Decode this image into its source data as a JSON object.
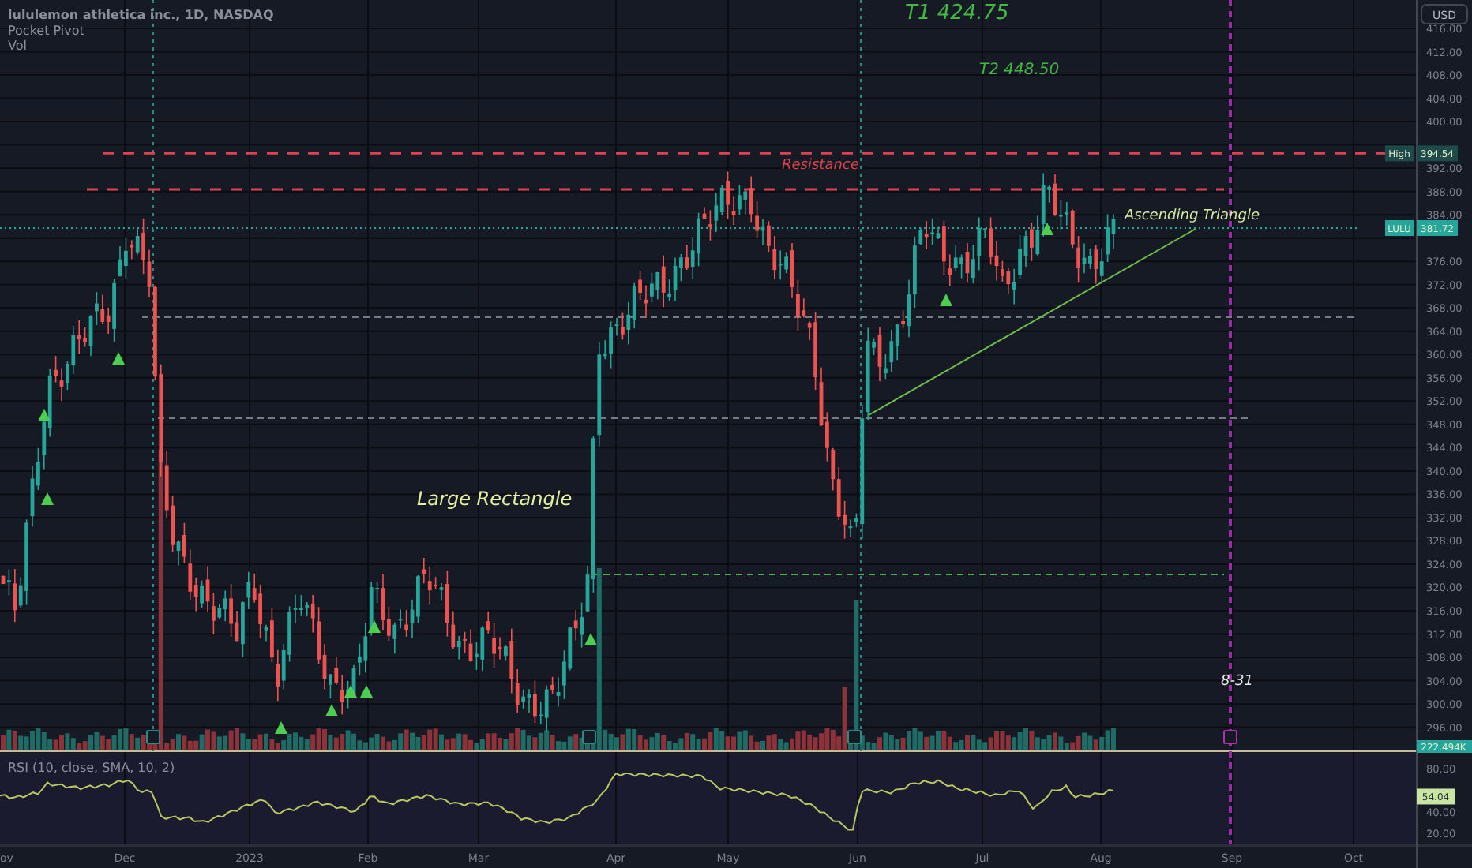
{
  "legend": {
    "symbol": "lululemon athletica inc., 1D, NASDAQ",
    "indicators": [
      "Pocket Pivot",
      "Vol"
    ]
  },
  "annotations": [
    {
      "text": "T1 424.75",
      "color": "#43b843"
    },
    {
      "text": "T2 448.50",
      "color": "#43b843"
    },
    {
      "text": "Resistance",
      "color": "#d8434b"
    },
    {
      "text": "Ascending Triangle",
      "color": "#d4eba0"
    },
    {
      "text": "Large Rectangle",
      "color": "#e6f0a0"
    },
    {
      "text": "8-31",
      "color": "#e8e8e8"
    }
  ],
  "price_axis": {
    "currency": "USD",
    "labels": [
      "416.00",
      "412.00",
      "408.00",
      "404.00",
      "400.00",
      "392.00",
      "388.00",
      "384.00",
      "376.00",
      "372.00",
      "368.00",
      "364.00",
      "360.00",
      "356.00",
      "352.00",
      "348.00",
      "344.00",
      "340.00",
      "336.00",
      "332.00",
      "328.00",
      "324.00",
      "320.00",
      "316.00",
      "312.00",
      "308.00",
      "304.00",
      "300.00",
      "296.00"
    ]
  },
  "price_badges": [
    {
      "kind": "high",
      "label": "High",
      "value": "394.54"
    },
    {
      "kind": "last",
      "label": "LULU",
      "value": "381.72"
    }
  ],
  "volume_badge": "222.494K",
  "rsi": {
    "title": "RSI (10, close, SMA, 10, 2)",
    "value": "54.04",
    "labels": [
      "80.00",
      "40.00",
      "20.00"
    ]
  },
  "time_axis": [
    "ov",
    "Dec",
    "2023",
    "Feb",
    "Mar",
    "Apr",
    "May",
    "Jun",
    "Jul",
    "Aug",
    "Sep",
    "Oct"
  ]
}
